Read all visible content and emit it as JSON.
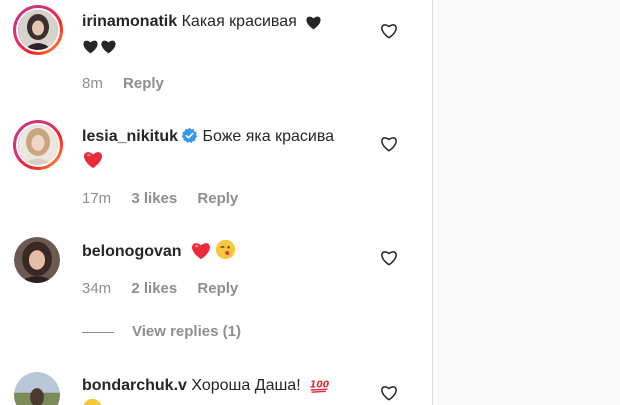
{
  "comments": [
    {
      "username": "irinamonatik",
      "text": "Какая красивая",
      "time": "8m",
      "likes": "",
      "reply_label": "Reply",
      "verified": false
    },
    {
      "username": "lesia_nikituk",
      "text": "Боже яка красива",
      "time": "17m",
      "likes": "3 likes",
      "reply_label": "Reply",
      "verified": true
    },
    {
      "username": "belonogovan",
      "text": "",
      "time": "34m",
      "likes": "2 likes",
      "reply_label": "Reply",
      "view_replies": "View replies (1)",
      "verified": false
    },
    {
      "username": "bondarchuk.v",
      "text": "Хороша Даша!",
      "verified": false
    }
  ],
  "colors": {
    "verified_badge": "#3897f0",
    "red_heart": "#ed2a3a",
    "black_heart": "#262626",
    "muted_text": "#8e8e8e"
  },
  "icons": [
    "heart-outline-icon",
    "verified-badge-icon",
    "black-heart-emoji",
    "red-heart-emoji",
    "face-emoji",
    "hundred-emoji"
  ]
}
